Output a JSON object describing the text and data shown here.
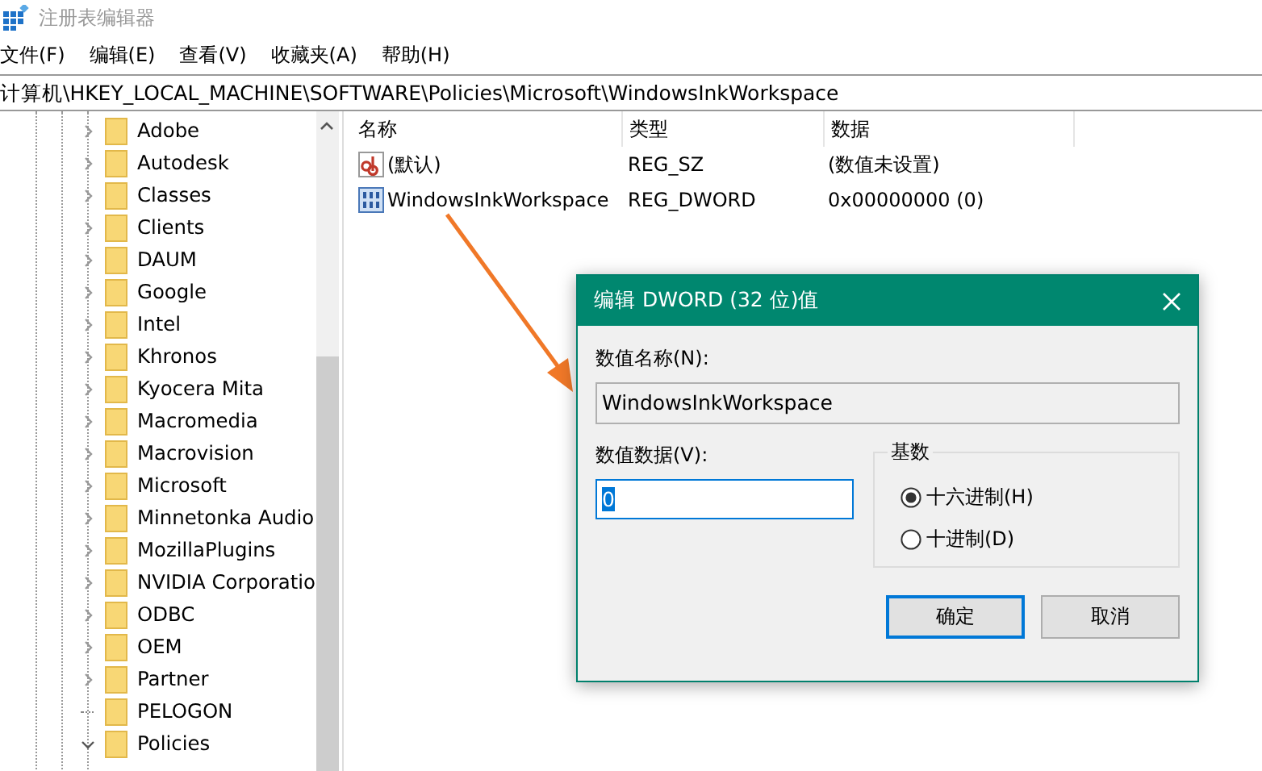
{
  "window": {
    "title": "注册表编辑器"
  },
  "menu": [
    "文件(F)",
    "编辑(E)",
    "查看(V)",
    "收藏夹(A)",
    "帮助(H)"
  ],
  "address": "计算机\\HKEY_LOCAL_MACHINE\\SOFTWARE\\Policies\\Microsoft\\WindowsInkWorkspace",
  "tree": [
    {
      "label": "Adobe",
      "kind": "collapsed"
    },
    {
      "label": "Autodesk",
      "kind": "collapsed"
    },
    {
      "label": "Classes",
      "kind": "collapsed"
    },
    {
      "label": "Clients",
      "kind": "collapsed"
    },
    {
      "label": "DAUM",
      "kind": "collapsed"
    },
    {
      "label": "Google",
      "kind": "collapsed"
    },
    {
      "label": "Intel",
      "kind": "collapsed"
    },
    {
      "label": "Khronos",
      "kind": "collapsed"
    },
    {
      "label": "Kyocera Mita",
      "kind": "collapsed"
    },
    {
      "label": "Macromedia",
      "kind": "collapsed"
    },
    {
      "label": "Macrovision",
      "kind": "collapsed"
    },
    {
      "label": "Microsoft",
      "kind": "collapsed"
    },
    {
      "label": "Minnetonka Audio",
      "kind": "collapsed"
    },
    {
      "label": "MozillaPlugins",
      "kind": "collapsed"
    },
    {
      "label": "NVIDIA Corporatio",
      "kind": "collapsed"
    },
    {
      "label": "ODBC",
      "kind": "collapsed"
    },
    {
      "label": "OEM",
      "kind": "collapsed"
    },
    {
      "label": "Partner",
      "kind": "collapsed"
    },
    {
      "label": "PELOGON",
      "kind": "leaf"
    },
    {
      "label": "Policies",
      "kind": "expanded"
    }
  ],
  "table": {
    "columns": [
      "名称",
      "类型",
      "数据"
    ],
    "rows": [
      {
        "kind": "string",
        "name": "(默认)",
        "type": "REG_SZ",
        "data": "(数值未设置)"
      },
      {
        "kind": "binary",
        "name": "WindowsInkWorkspace",
        "type": "REG_DWORD",
        "data": "0x00000000 (0)"
      }
    ]
  },
  "dialog": {
    "title": "编辑 DWORD (32 位)值",
    "name_label": "数值名称(N):",
    "name_value": "WindowsInkWorkspace",
    "data_label": "数值数据(V):",
    "data_value": "0",
    "data_highlighted": true,
    "base_label": "基数",
    "bases": [
      {
        "label": "十六进制(H)",
        "selected": true
      },
      {
        "label": "十进制(D)",
        "selected": false
      }
    ],
    "buttons": [
      {
        "label": "确定",
        "default": true
      },
      {
        "label": "取消",
        "default": false
      }
    ]
  }
}
